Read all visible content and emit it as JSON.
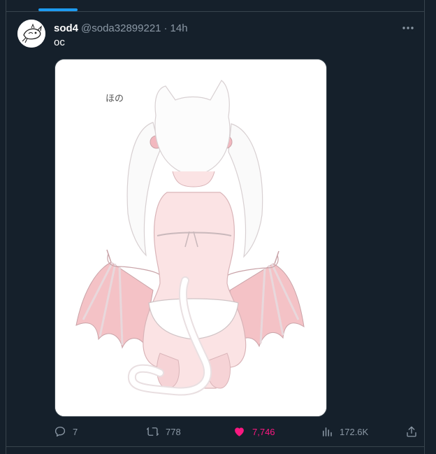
{
  "tweet": {
    "display_name": "sod4",
    "handle": "@soda32899221",
    "separator": "·",
    "time": "14h",
    "text": "oc",
    "image_text": "ほの"
  },
  "actions": {
    "replies": "7",
    "retweets": "778",
    "likes": "7,746",
    "views": "172.6K"
  },
  "icons": {
    "more": "more-horizontal-icon",
    "reply": "reply-icon",
    "retweet": "retweet-icon",
    "like": "heart-filled-icon",
    "views": "bar-chart-icon",
    "share": "share-icon"
  },
  "colors": {
    "background": "#15202b",
    "border": "#38444d",
    "accent": "#1d9bf0",
    "like": "#f91880",
    "muted": "#8b98a5"
  }
}
